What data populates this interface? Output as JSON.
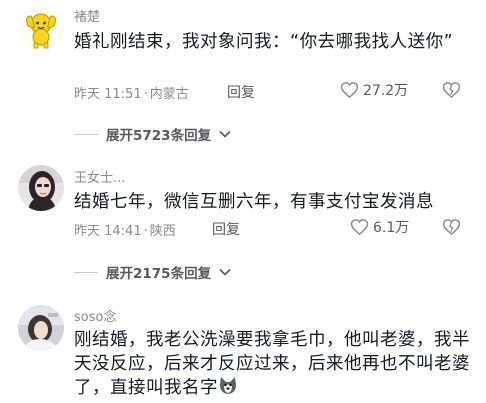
{
  "comments": [
    {
      "username": "褚楚",
      "text": "婚礼刚结束，我对象问我：“你去哪我找人送你”",
      "time": "昨天 11:51",
      "location": "内蒙古",
      "reply_label": "回复",
      "likes": "27.2万",
      "expand_label": "展开5723条回复",
      "avatar_icon": "yellow-cartoon-avatar"
    },
    {
      "username": "王女士...",
      "text": "结婚七年，微信互删六年，有事支付宝发消息",
      "time": "昨天 14:41",
      "location": "陕西",
      "reply_label": "回复",
      "likes": "6.1万",
      "expand_label": "展开2175条回复",
      "avatar_icon": "woman-photo-avatar"
    },
    {
      "username": "soso念",
      "text": "刚结婚，我老公洗澡要我拿毛巾，他叫老婆，我半天没反应，后来才反应过来，后来他再也不叫老婆了，直接叫我名字",
      "avatar_icon": "girl-photo-avatar",
      "trailing_emoji": "husky-emoji"
    }
  ],
  "separator": "·",
  "icons": {
    "like": "heart-icon",
    "dislike": "broken-heart-icon",
    "expand": "chevron-down-icon"
  }
}
